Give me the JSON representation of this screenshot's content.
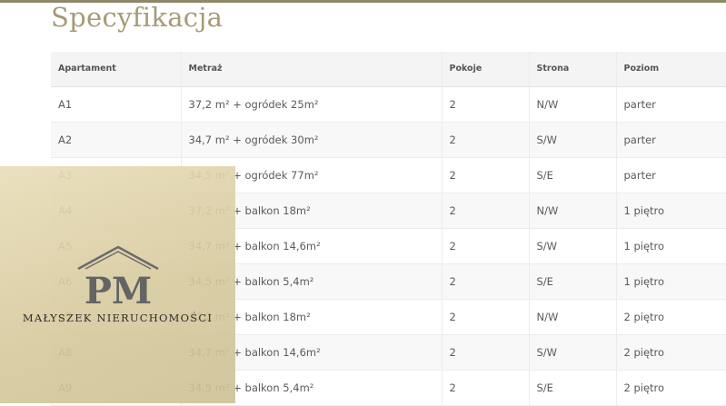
{
  "page": {
    "title": "Specyfikacja"
  },
  "table": {
    "headers": [
      "Apartament",
      "Metraż",
      "Pokoje",
      "Strona",
      "Poziom"
    ],
    "rows": [
      [
        "A1",
        "37,2 m² + ogródek 25m²",
        "2",
        "N/W",
        "parter"
      ],
      [
        "A2",
        "34,7 m² + ogródek 30m²",
        "2",
        "S/W",
        "parter"
      ],
      [
        "A3",
        "34,5 m² + ogródek 77m²",
        "2",
        "S/E",
        "parter"
      ],
      [
        "A4",
        "37,2 m² + balkon 18m²",
        "2",
        "N/W",
        "1 piętro"
      ],
      [
        "A5",
        "34,7 m² + balkon 14,6m²",
        "2",
        "S/W",
        "1 piętro"
      ],
      [
        "A6",
        "34,5 m² + balkon 5,4m²",
        "2",
        "S/E",
        "1 piętro"
      ],
      [
        "A7",
        "37,2 m² + balkon 18m²",
        "2",
        "N/W",
        "2 piętro"
      ],
      [
        "A8",
        "34,7 m² + balkon 14,6m²",
        "2",
        "S/W",
        "2 piętro"
      ],
      [
        "A9",
        "34,5 m² + balkon 5,4m²",
        "2",
        "S/E",
        "2 piętro"
      ]
    ]
  },
  "watermark": {
    "monogram": "PM",
    "text": "MAŁYSZEK NIERUCHOMOŚCI"
  },
  "colors": {
    "title": "#a79a77",
    "top_rule": "#8e8868",
    "watermark_bg": "#d9cc9f"
  }
}
